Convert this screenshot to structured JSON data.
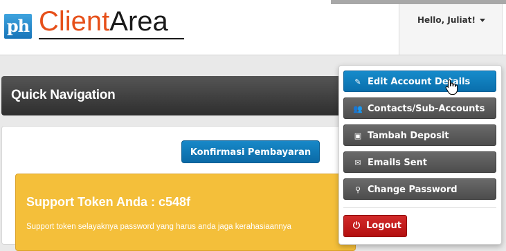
{
  "header": {
    "logo": {
      "mark": "ph",
      "client": "Client",
      "area": "Area"
    },
    "greeting": "Hello, Juliat!"
  },
  "quick_nav": {
    "title": "Quick Navigation"
  },
  "main": {
    "confirm_button": "Konfirmasi Pembayaran",
    "token": {
      "title": "Support Token Anda : c548f",
      "text": "Support token selayaknya password yang harus anda jaga kerahasiaannya"
    }
  },
  "dropdown": {
    "items": [
      {
        "label": "Edit Account Details",
        "icon": "pencil-icon",
        "glyph": "✎"
      },
      {
        "label": "Contacts/Sub-Accounts",
        "icon": "users-icon",
        "glyph": "👥"
      },
      {
        "label": "Tambah Deposit",
        "icon": "wallet-icon",
        "glyph": "▣"
      },
      {
        "label": "Emails Sent",
        "icon": "envelope-icon",
        "glyph": "✉"
      },
      {
        "label": "Change Password",
        "icon": "key-icon",
        "glyph": "⚲"
      }
    ],
    "logout": {
      "label": "Logout",
      "icon": "power-icon",
      "glyph": "⏻"
    }
  },
  "colors": {
    "accent": "#0b6aa6",
    "logo_orange": "#e6501a",
    "warning": "#f4bf3a",
    "danger": "#c41c1c",
    "menu_dark": "#5a5a5a"
  }
}
